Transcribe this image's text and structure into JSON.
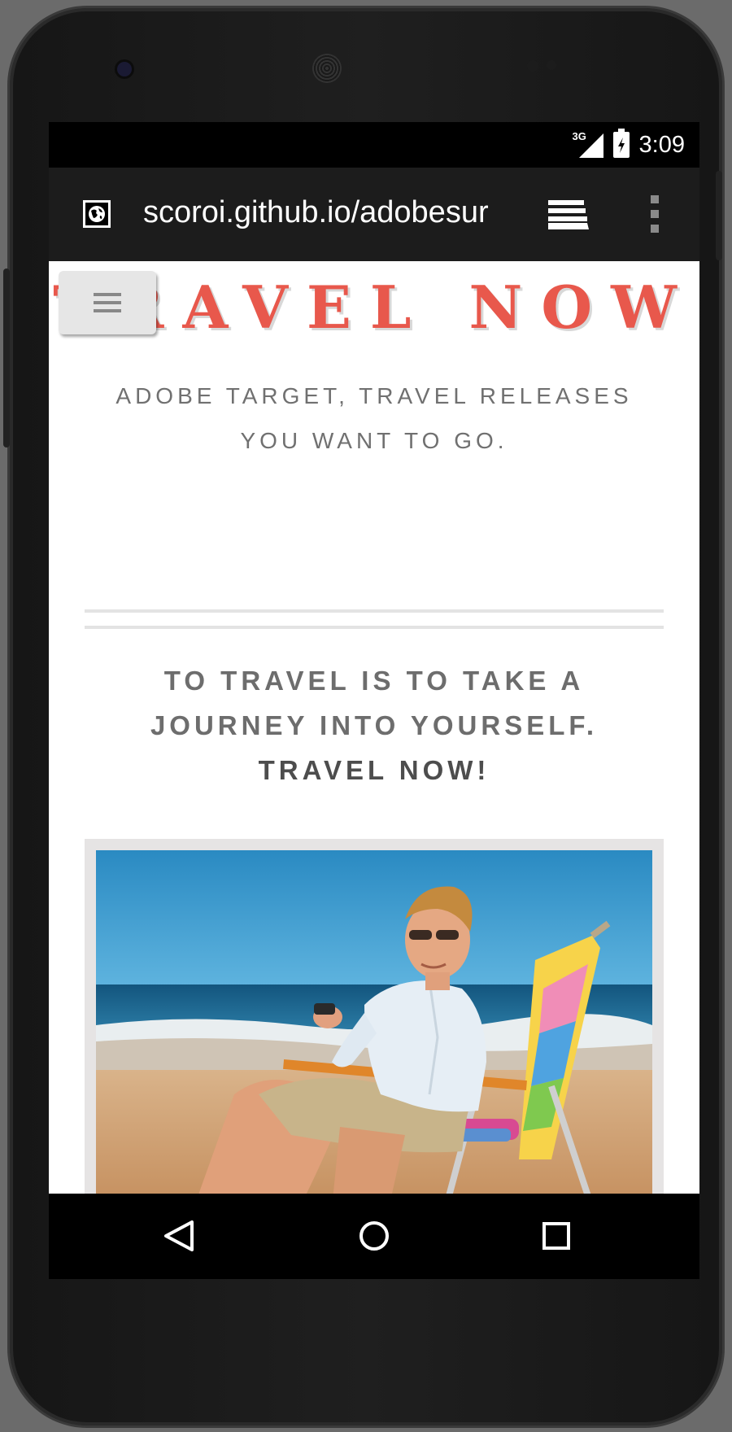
{
  "status_bar": {
    "network_label": "3G",
    "time": "3:09",
    "icons": [
      "signal-icon",
      "battery-icon"
    ]
  },
  "browser": {
    "url": "scoroi.github.io/adobesur",
    "icons": [
      "globe-icon",
      "tabs-icon",
      "overflow-menu-icon"
    ]
  },
  "page": {
    "title": "TRAVEL NOW",
    "subtitle": "ADOBE TARGET, TRAVEL RELEASES YOU WANT TO GO.",
    "quote": "TO TRAVEL IS TO TAKE A JOURNEY INTO YOURSELF.",
    "cta": "TRAVEL NOW!",
    "menu_icon": "hamburger-icon",
    "image_subject": "man-on-beach-chair-photo"
  },
  "nav_bar": {
    "icons": [
      "back-icon",
      "home-icon",
      "recents-icon"
    ]
  },
  "colors": {
    "title": "#e8584c",
    "text": "#6d6d6d",
    "sky": "#2f8fc4",
    "sand": "#d2a272"
  }
}
